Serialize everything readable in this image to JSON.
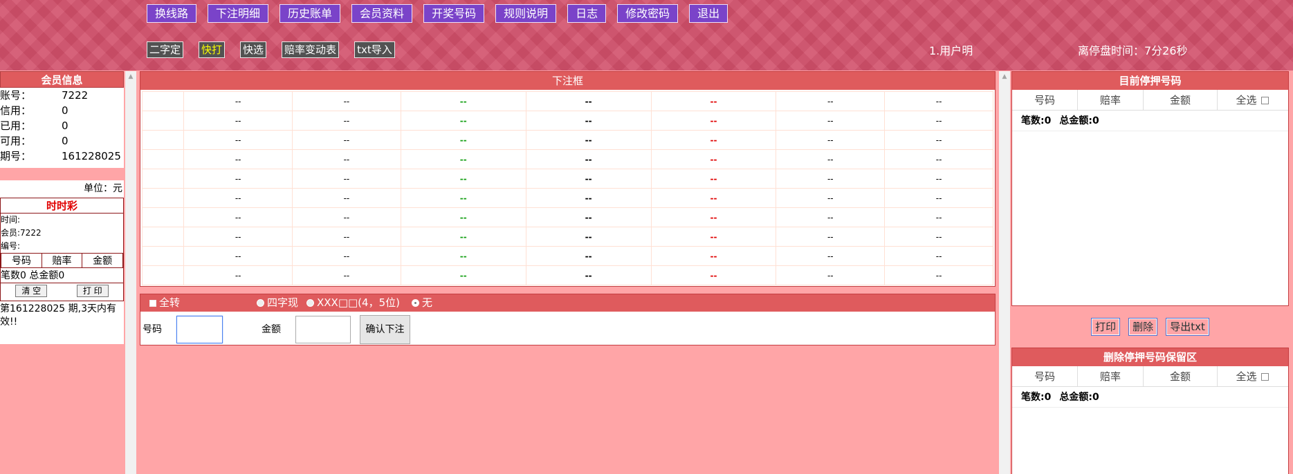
{
  "topnav": [
    "换线路",
    "下注明细",
    "历史账单",
    "会员资料",
    "开奖号码",
    "规则说明",
    "日志",
    "修改密码",
    "退出"
  ],
  "subnav": [
    "二字定",
    "快打",
    "快选",
    "赔率变动表",
    "txt导入"
  ],
  "header": {
    "user": "1.用户明",
    "timer": "离停盘时间：7分26秒"
  },
  "member": {
    "title": "会员信息",
    "rows": [
      {
        "k": "账号：",
        "v": "7222"
      },
      {
        "k": "信用：",
        "v": "0"
      },
      {
        "k": "已用：",
        "v": "0"
      },
      {
        "k": "可用：",
        "v": "0"
      },
      {
        "k": "期号：",
        "v": "161228025"
      }
    ],
    "unit": "单位：元"
  },
  "ticket": {
    "title": "时时彩",
    "time": "时间:",
    "member": "会员:7222",
    "serial": "编号:",
    "cols": [
      "号码",
      "赔率",
      "金额"
    ],
    "sum": "笔数0 总金额0",
    "clear": "清 空",
    "print": "打 印"
  },
  "notice": "第161228025 期,3天内有效!!",
  "center": {
    "title": "下注框",
    "placeholder": "--",
    "rows": 10
  },
  "options": {
    "all": "全转",
    "four": "四字现",
    "xxx": "XXX□□(4，5位)",
    "none": "无",
    "num_label": "号码",
    "amt_label": "金额",
    "confirm": "确认下注"
  },
  "right": {
    "title1": "目前停押号码",
    "title2": "删除停押号码保留区",
    "cols": [
      "号码",
      "赔率",
      "金额",
      "全选"
    ],
    "count": "笔数:0",
    "total": "总金额:0",
    "btns": [
      "打印",
      "删除",
      "导出txt"
    ]
  },
  "colors": {
    "header": "#d24f6a",
    "panel_title": "#df5b5d",
    "bg": "#ffa5a7",
    "nav_btn": "#7a43c9"
  }
}
